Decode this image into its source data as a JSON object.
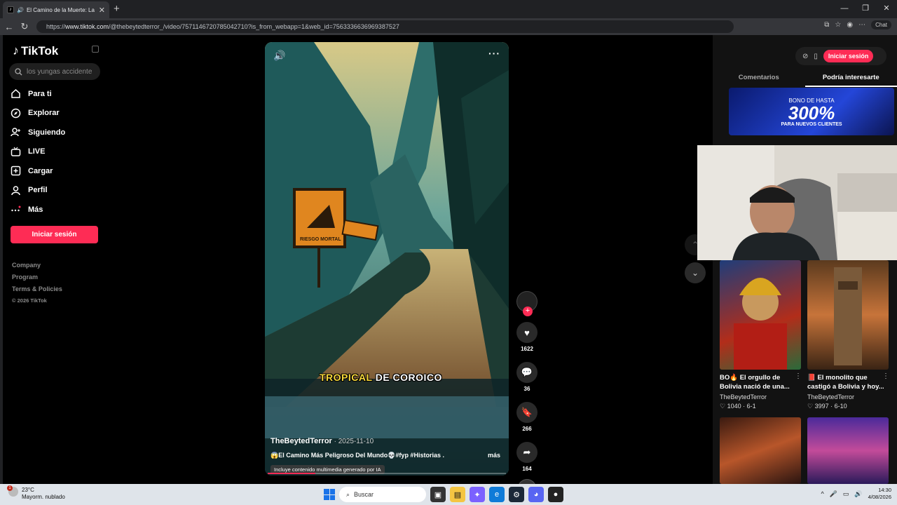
{
  "browser": {
    "tab_title": "El Camino de la Muerte: La R",
    "url_prefix": "https://",
    "url_domain": "www.tiktok.com",
    "url_path": "/@thebeytedterror_/video/7571146720785042710?is_from_webapp=1&web_id=7563336636969387527",
    "chat_label": "Chat"
  },
  "sidebar": {
    "logo": "TikTok",
    "search_placeholder": "los yungas accidente",
    "nav": [
      {
        "label": "Para ti",
        "icon": "home-icon"
      },
      {
        "label": "Explorar",
        "icon": "compass-icon"
      },
      {
        "label": "Siguiendo",
        "icon": "following-icon"
      },
      {
        "label": "LIVE",
        "icon": "live-icon"
      },
      {
        "label": "Cargar",
        "icon": "upload-icon"
      },
      {
        "label": "Perfil",
        "icon": "profile-icon"
      },
      {
        "label": "Más",
        "icon": "more-icon"
      }
    ],
    "login_label": "Iniciar sesión",
    "footer": [
      "Company",
      "Program",
      "Terms & Policies",
      "© 2026 TikTok"
    ]
  },
  "video": {
    "sign_text": "RIESGO MORTAL",
    "overlay_word_1": "TROPICAL",
    "overlay_word_2": "DE COROICO",
    "author": "TheBeytedTerror",
    "date": "2025-11-10",
    "description": "😱El Camino Más Peligroso Del Mundo💀#fyp #Historias ...",
    "more_label": "más",
    "ai_label": "Incluye contenido multimedia generado por IA",
    "progress_fraction": 0.2
  },
  "actions": {
    "likes": "1622",
    "comments": "36",
    "saves": "266",
    "shares": "164"
  },
  "right_panel": {
    "login_label": "Iniciar sesión",
    "tabs": [
      "Comentarios",
      "Podría interesarte"
    ],
    "active_tab": 1,
    "banner": {
      "line1": "BONO DE HASTA",
      "line2": "300%",
      "line3": "PARA NUEVOS CLIENTES"
    },
    "cards": [
      {
        "title": "BO🔥 El orgullo de Bolivia nació de una...",
        "user": "TheBeytedTerror",
        "stats": "♡ 1040 · 6-1"
      },
      {
        "title": "📕 El monolito que castigó a Bolivia y hoy...",
        "user": "TheBeytedTerror",
        "stats": "♡ 3997 · 6-10"
      }
    ]
  },
  "taskbar": {
    "temp": "23°C",
    "weather": "Mayorm. nublado",
    "search_label": "Buscar",
    "time": "14:30",
    "date": "4/08/2026"
  }
}
